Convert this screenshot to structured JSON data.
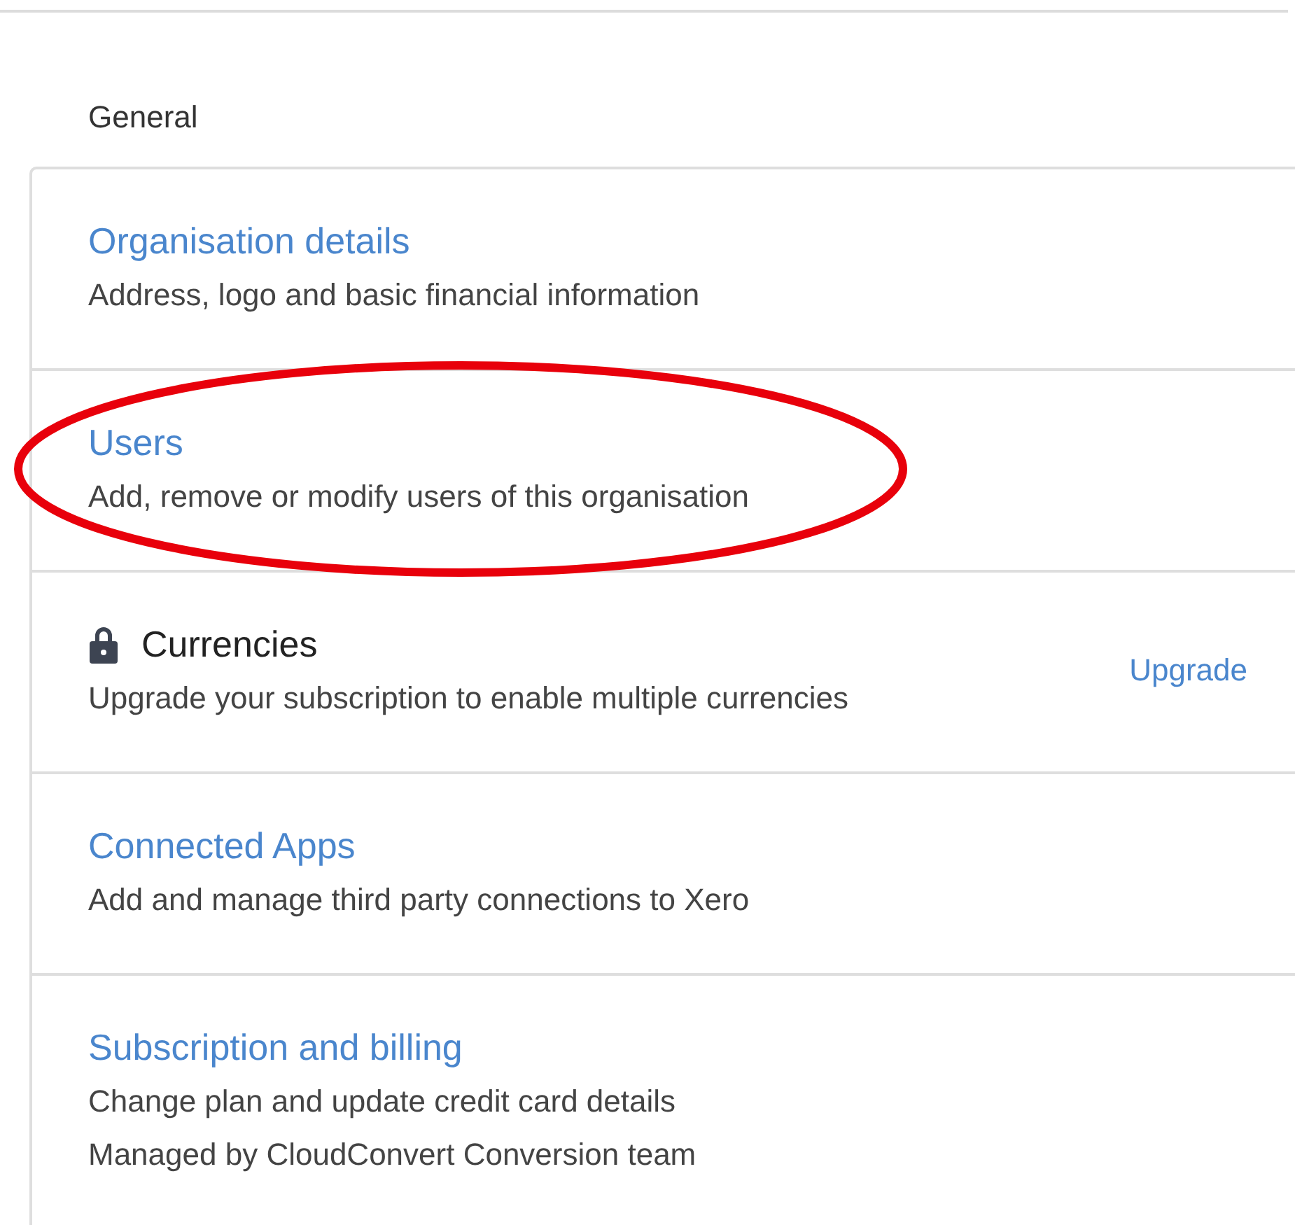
{
  "section_title": "General",
  "items": [
    {
      "kind": "link",
      "title": "Organisation details",
      "descriptions": [
        "Address, logo and basic financial information"
      ],
      "highlighted": false
    },
    {
      "kind": "link",
      "title": "Users",
      "descriptions": [
        "Add, remove or modify users of this organisation"
      ],
      "highlighted": true
    },
    {
      "kind": "locked",
      "title": "Currencies",
      "descriptions": [
        "Upgrade your subscription to enable multiple currencies"
      ],
      "action": "Upgrade",
      "highlighted": false
    },
    {
      "kind": "link",
      "title": "Connected Apps",
      "descriptions": [
        "Add and manage third party connections to Xero"
      ],
      "highlighted": false
    },
    {
      "kind": "link",
      "title": "Subscription and billing",
      "descriptions": [
        "Change plan and update credit card details",
        "Managed by CloudConvert Conversion team"
      ],
      "highlighted": false
    }
  ]
}
